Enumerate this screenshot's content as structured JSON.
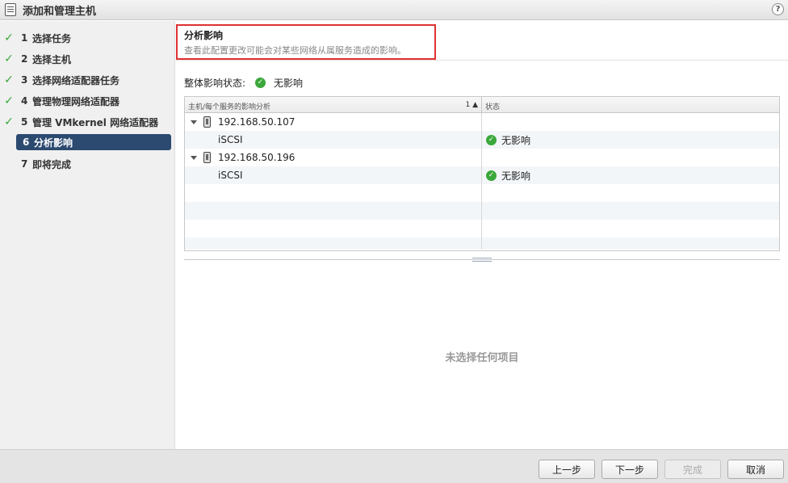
{
  "window": {
    "title": "添加和管理主机",
    "help": "?"
  },
  "steps": [
    {
      "num": "1",
      "label": "选择任务",
      "state": "done"
    },
    {
      "num": "2",
      "label": "选择主机",
      "state": "done"
    },
    {
      "num": "3",
      "label": "选择网络适配器任务",
      "state": "done"
    },
    {
      "num": "4",
      "label": "管理物理网络适配器",
      "state": "done"
    },
    {
      "num": "5",
      "label": "管理 VMkernel 网络适配器",
      "state": "done"
    },
    {
      "num": "6",
      "label": "分析影响",
      "state": "active"
    },
    {
      "num": "7",
      "label": "即将完成",
      "state": "future"
    }
  ],
  "header": {
    "title": "分析影响",
    "subtitle": "查看此配置更改可能会对某些网络从属服务造成的影响。"
  },
  "overall": {
    "label": "整体影响状态:",
    "value": "无影响"
  },
  "grid": {
    "columns": [
      "主机/每个服务的影响分析",
      "状态"
    ],
    "sort_indicator": "1 ▲",
    "rows": [
      {
        "type": "host",
        "name": "192.168.50.107",
        "status": ""
      },
      {
        "type": "service",
        "name": "iSCSI",
        "status": "无影响"
      },
      {
        "type": "host",
        "name": "192.168.50.196",
        "status": ""
      },
      {
        "type": "service",
        "name": "iSCSI",
        "status": "无影响"
      }
    ]
  },
  "detail": {
    "empty_message": "未选择任何项目"
  },
  "footer": {
    "back": "上一步",
    "next": "下一步",
    "finish": "完成",
    "cancel": "取消"
  },
  "colors": {
    "active_step": "#2c4a70",
    "ok": "#3aa83a",
    "highlight": "#e03131"
  }
}
